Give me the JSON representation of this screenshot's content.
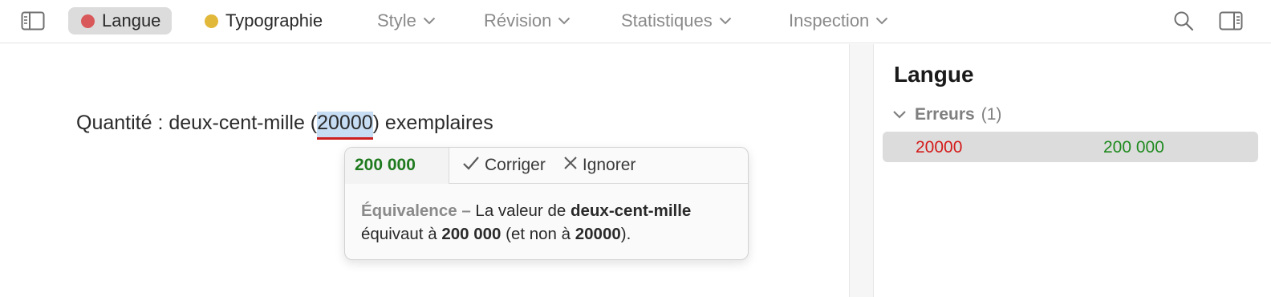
{
  "toolbar": {
    "sidebar_icon": "sidebar-left-icon",
    "tabs": [
      {
        "label": "Langue",
        "dot_color": "#d9595a",
        "active": true
      },
      {
        "label": "Typographie",
        "dot_color": "#e2b83a",
        "active": false
      }
    ],
    "menus": [
      {
        "label": "Style",
        "icon": "chevron-down-icon"
      },
      {
        "label": "Révision",
        "icon": "chevron-down-icon"
      },
      {
        "label": "Statistiques",
        "icon": "chevron-down-icon"
      },
      {
        "label": "Inspection",
        "icon": "chevron-down-icon"
      }
    ],
    "search_icon": "search-icon",
    "inspector_icon": "sidebar-right-icon"
  },
  "editor": {
    "text_before": "Quantité : deux-cent-mille (",
    "flagged": "20000",
    "text_after": ") exemplaires"
  },
  "popover": {
    "suggestion": "200 000",
    "fix_label": "Corriger",
    "ignore_label": "Ignorer",
    "rule_name": "Équivalence –",
    "msg_1": " La valeur de ",
    "msg_bold_1": "deux-cent-mille",
    "msg_2": " équivaut à ",
    "msg_bold_2": "200 000",
    "msg_3": " (et non à ",
    "msg_bold_3": "20000",
    "msg_4": ")."
  },
  "panel": {
    "title": "Langue",
    "group_label": "Erreurs",
    "group_count": "(1)",
    "errors": [
      {
        "original": "20000",
        "correction": "200 000"
      }
    ]
  },
  "colors": {
    "error_red": "#cc1f1f",
    "fix_green": "#1f7a1f",
    "selection": "#c7ddf3"
  }
}
